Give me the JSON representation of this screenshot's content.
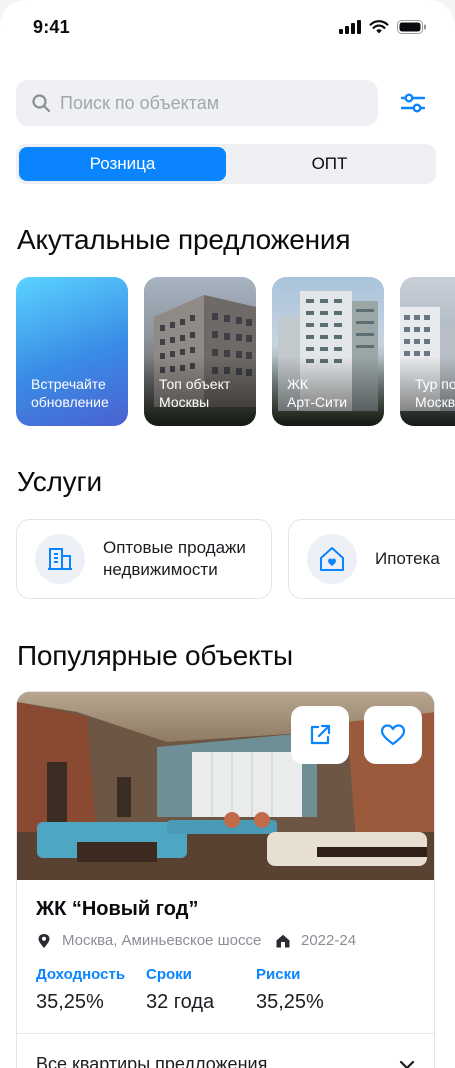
{
  "status": {
    "time": "9:41"
  },
  "search": {
    "placeholder": "Поиск по объектам"
  },
  "segments": [
    {
      "label": "Розница",
      "active": true
    },
    {
      "label": "ОПТ",
      "active": false
    }
  ],
  "offers_section": {
    "title": "Акутальные предложения",
    "items": [
      {
        "label": "Встречайте\nобновление"
      },
      {
        "label": "Топ объект\nМосквы"
      },
      {
        "label": "ЖК\nАрт-Сити"
      },
      {
        "label": "Тур по\nМоскве"
      }
    ]
  },
  "services_section": {
    "title": "Услуги",
    "items": [
      {
        "label": "Оптовые продажи\nнедвижимости",
        "icon": "building-icon"
      },
      {
        "label": "Ипотека",
        "icon": "home-heart-icon"
      }
    ]
  },
  "popular_section": {
    "title": "Популярные объекты",
    "card": {
      "name": "ЖК “Новый год”",
      "address": "Москва, Аминьевское шоссе",
      "years": "2022-24",
      "stats": [
        {
          "label": "Доходность",
          "value": "35,25%"
        },
        {
          "label": "Сроки",
          "value": "32 года"
        },
        {
          "label": "Риски",
          "value": "35,25%"
        }
      ],
      "all_label": "Все квартиры предложения"
    }
  },
  "colors": {
    "accent": "#0a84ff",
    "background": "#ffffff",
    "chip": "#eff0f3"
  }
}
